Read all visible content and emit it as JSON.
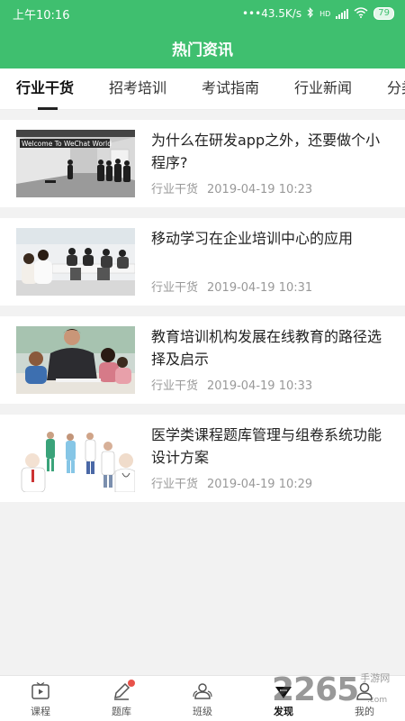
{
  "status_bar": {
    "time": "上午10:16",
    "network_speed": "43.5K/s",
    "network_type": "HD",
    "battery": "79"
  },
  "header": {
    "title": "热门资讯"
  },
  "tabs": [
    {
      "label": "行业干货",
      "active": true
    },
    {
      "label": "招考培训",
      "active": false
    },
    {
      "label": "考试指南",
      "active": false
    },
    {
      "label": "行业新闻",
      "active": false
    },
    {
      "label": "分类",
      "active": false
    }
  ],
  "articles": [
    {
      "title": "为什么在研发app之外，还要做个小程序?",
      "category": "行业干货",
      "date": "2019-04-19 10:23",
      "image": "wechat-conference-photo",
      "image_sign_text": "Welcome To WeChat World"
    },
    {
      "title": "移动学习在企业培训中心的应用",
      "category": "行业干货",
      "date": "2019-04-19 10:31",
      "image": "office-training-photo"
    },
    {
      "title": "教育培训机构发展在线教育的路径选择及启示",
      "category": "行业干货",
      "date": "2019-04-19 10:33",
      "image": "teacher-children-photo"
    },
    {
      "title": "医学类课程题库管理与组卷系统功能设计方案",
      "category": "行业干货",
      "date": "2019-04-19 10:29",
      "image": "medical-staff-photo"
    }
  ],
  "bottom_nav": [
    {
      "label": "课程",
      "icon": "play-video-icon",
      "active": false,
      "badge": false
    },
    {
      "label": "题库",
      "icon": "pencil-icon",
      "active": false,
      "badge": true
    },
    {
      "label": "班级",
      "icon": "group-icon",
      "active": false,
      "badge": false
    },
    {
      "label": "发现",
      "icon": "discover-icon",
      "active": true,
      "badge": false
    },
    {
      "label": "我的",
      "icon": "user-icon",
      "active": false,
      "badge": false
    }
  ],
  "watermark": {
    "text": "2265",
    "suffix": "手游网",
    "url": ".com"
  },
  "colors": {
    "brand_green": "#3fbf6f",
    "badge_red": "#e8524a",
    "meta_gray": "#999999"
  }
}
